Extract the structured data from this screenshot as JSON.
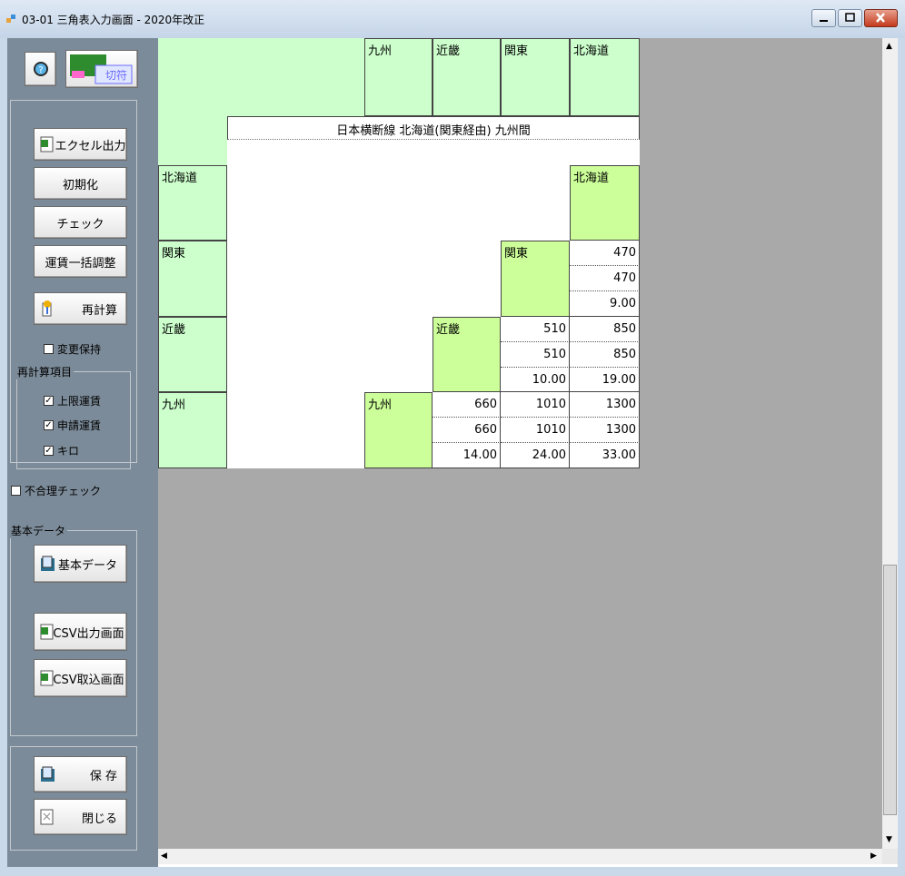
{
  "window": {
    "title": "03-01 三角表入力画面 - 2020年改正"
  },
  "sidebar": {
    "buttons": {
      "excel": "エクセル出力",
      "init": "初期化",
      "check": "チェック",
      "fare_adjust": "運賃一括調整",
      "recalc": "再計算",
      "basic_data": "基本データ",
      "csv_out": "CSV出力画面",
      "csv_in": "CSV取込画面",
      "save": "保 存",
      "close": "閉じる"
    },
    "ticket_icon_label": "切符",
    "keep_changes": "変更保持",
    "recalc_group": {
      "label": "再計算項目",
      "items": [
        "上限運賃",
        "申請運賃",
        "キロ"
      ]
    },
    "irrational_check": "不合理チェック",
    "basic_group_label": "基本データ"
  },
  "table": {
    "columns": [
      "九州",
      "近畿",
      "関東",
      "北海道"
    ],
    "banner": "日本横断線 北海道(関東経由) 九州間",
    "rows": [
      "北海道",
      "関東",
      "近畿",
      "九州"
    ],
    "kanto_row": {
      "hokkaido": [
        "470",
        "470",
        "9.00"
      ]
    },
    "kinki_row": {
      "kanto": [
        "510",
        "510",
        "10.00"
      ],
      "hokkaido": [
        "850",
        "850",
        "19.00"
      ]
    },
    "kyushu_row": {
      "kinki": [
        "660",
        "660",
        "14.00"
      ],
      "kanto": [
        "1010",
        "1010",
        "24.00"
      ],
      "hokkaido": [
        "1300",
        "1300",
        "33.00"
      ]
    }
  },
  "colors": {
    "header_bg": "#ccffcc",
    "diagonal_bg": "#ccff99",
    "sidebar_bg": "#7c8b99",
    "content_bg": "#a9a9a9"
  }
}
